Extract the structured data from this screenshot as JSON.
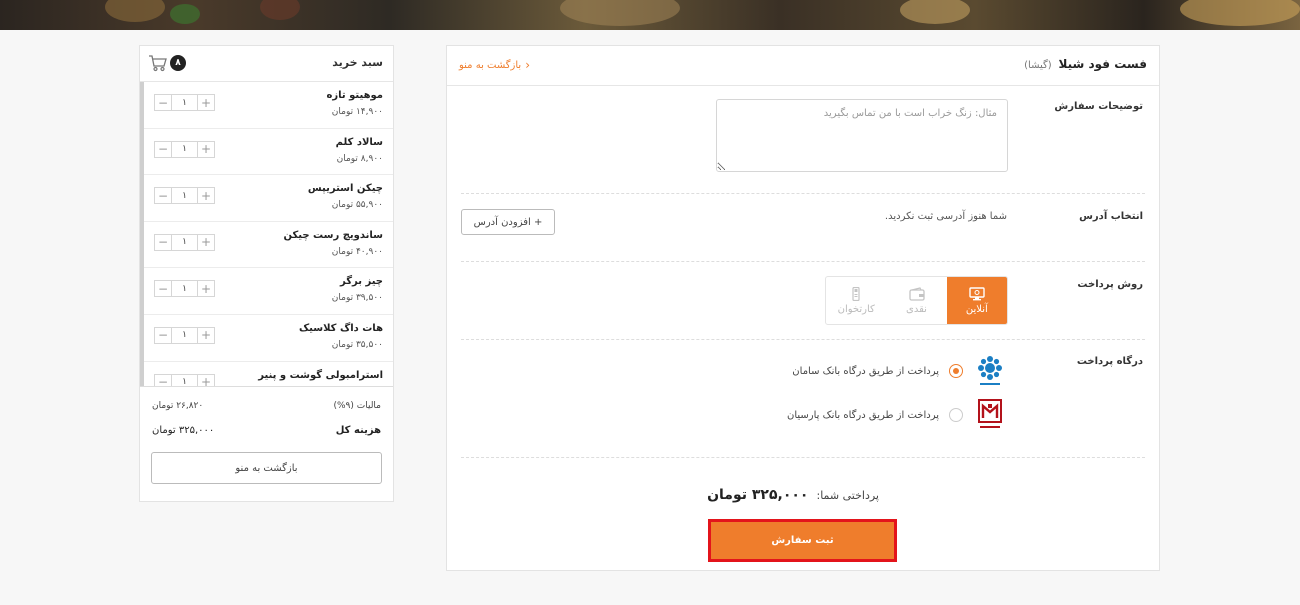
{
  "colors": {
    "accent": "#ef7d2c",
    "highlight_border": "#e3141b"
  },
  "order": {
    "restaurant": "فست فود شیلا",
    "branch": "(گیشا)",
    "back_to_menu": "بازگشت به منو",
    "notes_label": "توضیحات سفارش",
    "notes_placeholder": "مثال: زنگ خراب است با من تماس بگیرید",
    "address_label": "انتخاب آدرس",
    "address_empty": "شما هنوز آدرسی ثبت نکردید.",
    "add_address": "+ افزودن آدرس",
    "payment_label": "روش پرداخت",
    "payment_methods": [
      {
        "label": "آنلاین",
        "icon": "monitor-icon",
        "active": true
      },
      {
        "label": "نقدی",
        "icon": "wallet-icon",
        "active": false
      },
      {
        "label": "کارتخوان",
        "icon": "card-reader-icon",
        "active": false
      }
    ],
    "gateway_label": "درگاه پرداخت",
    "gateways": [
      {
        "label": "پرداخت از طریق درگاه بانک سامان",
        "logo": "saman-bank-logo",
        "selected": true
      },
      {
        "label": "پرداخت از طریق درگاه بانک پارسیان",
        "logo": "parsian-bank-logo",
        "selected": false
      }
    ],
    "payable_label": "پرداختی شما:",
    "payable_amount": "۳۲۵,۰۰۰ تومان",
    "submit": "ثبت سفارش"
  },
  "cart": {
    "title": "سبد خرید",
    "count": "۸",
    "items": [
      {
        "name": "موهیتو تازه",
        "price": "۱۴,۹۰۰ تومان",
        "qty": "۱"
      },
      {
        "name": "سالاد کلم",
        "price": "۸,۹۰۰ تومان",
        "qty": "۱"
      },
      {
        "name": "چیکن استریپس",
        "price": "۵۵,۹۰۰ تومان",
        "qty": "۱"
      },
      {
        "name": "ساندویچ رست چیکن",
        "price": "۴۰,۹۰۰ تومان",
        "qty": "۱"
      },
      {
        "name": "چیز برگر",
        "price": "۳۹,۵۰۰ تومان",
        "qty": "۱"
      },
      {
        "name": "هات داگ کلاسیک",
        "price": "۳۵,۵۰۰ تومان",
        "qty": "۱"
      },
      {
        "name": "استرامبولی گوشت و پنیر",
        "price": "",
        "qty": "۱"
      }
    ],
    "tax_label": "مالیات (۹%)",
    "tax_value": "۲۶,۸۲۰ تومان",
    "total_label": "هزینه کل",
    "total_value": "۳۲۵,۰۰۰ تومان",
    "back_button": "بازگشت به منو"
  }
}
